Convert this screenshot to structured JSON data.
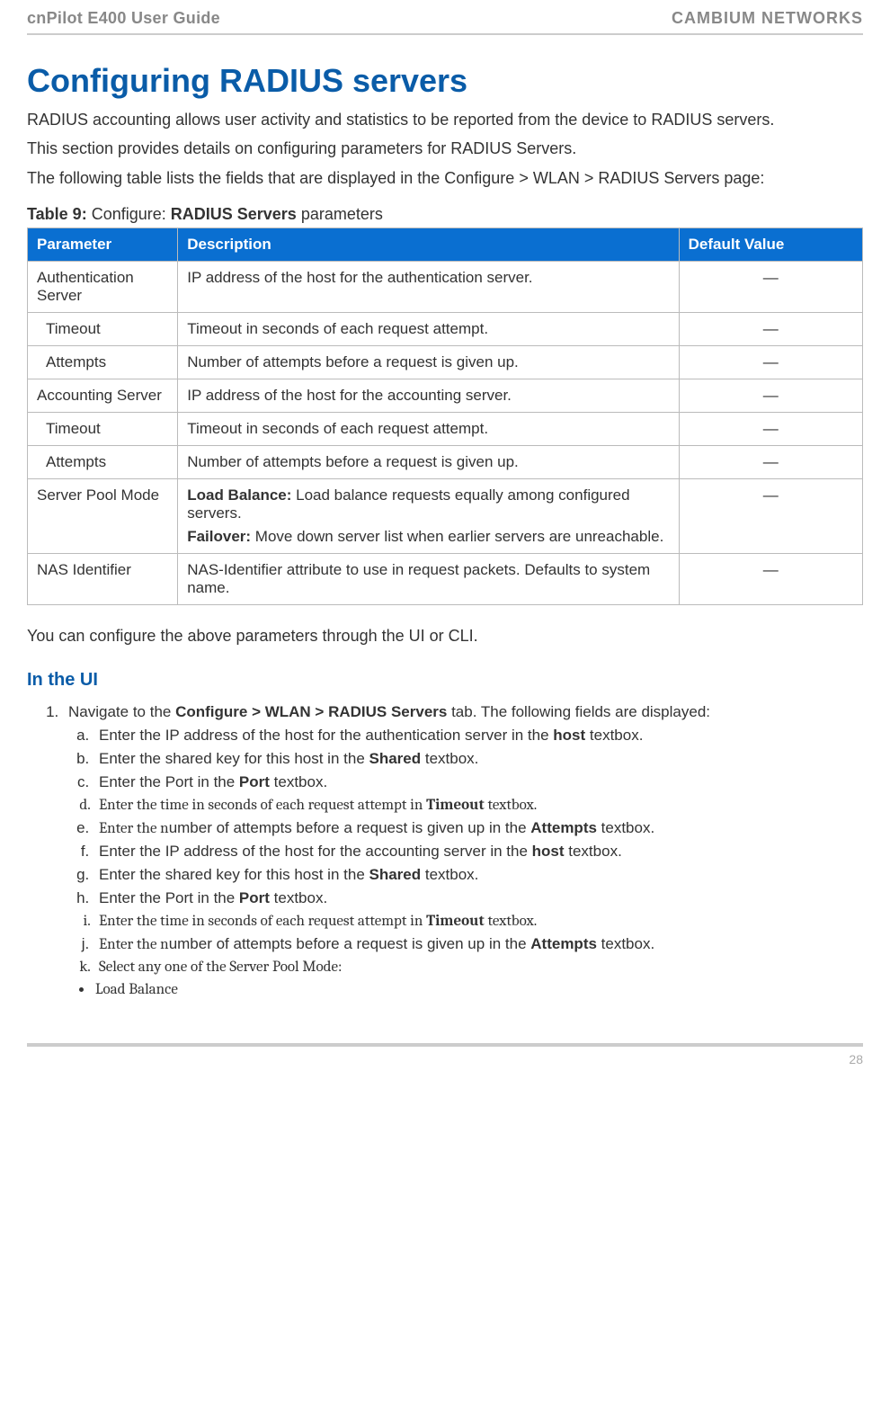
{
  "header": {
    "doc_title": "cnPilot E400 User Guide",
    "brand": "CAMBIUM NETWORKS"
  },
  "section": {
    "title": "Configuring RADIUS servers",
    "p1": "RADIUS accounting allows user activity and statistics to be reported from the device to RADIUS servers.",
    "p2": "This section provides details on configuring parameters for RADIUS Servers.",
    "p3": "The following table lists the fields that are displayed in the Configure > WLAN > RADIUS Servers page:"
  },
  "table": {
    "caption_prefix": "Table 9:",
    "caption_mid": " Configure: ",
    "caption_bold2": "RADIUS Servers",
    "caption_suffix": " parameters",
    "headers": {
      "parameter": "Parameter",
      "description": "Description",
      "default_value": "Default Value"
    },
    "rows": [
      {
        "param": "Authentication Server",
        "indent": 0,
        "desc_plain": "IP address of the host for the authentication server.",
        "default": "—"
      },
      {
        "param": "Timeout",
        "indent": 1,
        "desc_plain": "Timeout in seconds of each request attempt.",
        "default": "—"
      },
      {
        "param": "Attempts",
        "indent": 1,
        "desc_plain": "Number of attempts before a request is given up.",
        "default": "—"
      },
      {
        "param": "Accounting Server",
        "indent": 0,
        "desc_plain": "IP address of the host for the accounting server.",
        "default": "—"
      },
      {
        "param": "Timeout",
        "indent": 1,
        "desc_plain": "Timeout in seconds of each request attempt.",
        "default": "—"
      },
      {
        "param": "Attempts",
        "indent": 1,
        "desc_plain": "Number of attempts before a request is given up.",
        "default": "—"
      },
      {
        "param": "Server Pool Mode",
        "indent": 0,
        "desc_rich": [
          {
            "bold": "Load Balance:",
            "text": " Load balance requests equally among configured servers."
          },
          {
            "bold": "Failover:",
            "text": " Move down server list when earlier servers are unreachable."
          }
        ],
        "default": "—"
      },
      {
        "param": "NAS Identifier",
        "indent": 0,
        "desc_plain": "NAS-Identifier attribute to use in request packets. Defaults to system name.",
        "default": "—"
      }
    ]
  },
  "post_table_text": "You can configure the above parameters through the UI or CLI.",
  "ui_heading": "In the UI",
  "steps": {
    "step1_pre": "Navigate to the ",
    "step1_bold": "Configure > WLAN > RADIUS Servers",
    "step1_post": " tab. The following fields are displayed:",
    "substeps": [
      {
        "pre": "Enter the IP address of the host for the authentication server in the ",
        "bold": "host",
        "post": " textbox.",
        "serif": false
      },
      {
        "pre": "Enter the shared key for this host in the ",
        "bold": "Shared",
        "post": " textbox.",
        "serif": false
      },
      {
        "pre": "Enter the Port in the ",
        "bold": "Port",
        "post": " textbox.",
        "serif": false
      },
      {
        "pre": "Enter the time in seconds of each request attempt in ",
        "bold": "Timeout",
        "post": " textbox.",
        "serif": true
      },
      {
        "pre_serif": "Enter the n",
        "pre": "umber of attempts before a request is given up in the ",
        "bold": "Attempts",
        "post": " textbox.",
        "serif": false,
        "mixed": true
      },
      {
        "pre": "Enter the IP address of the host for the accounting server in the ",
        "bold": "host",
        "post": " textbox.",
        "serif": false
      },
      {
        "pre": "Enter the shared key for this host in the ",
        "bold": "Shared",
        "post": " textbox.",
        "serif": false
      },
      {
        "pre": "Enter the Port in the ",
        "bold": "Port",
        "post": " textbox.",
        "serif": false
      },
      {
        "pre": "Enter the time in seconds of each request attempt in ",
        "bold": "Timeout",
        "post": " textbox.",
        "serif": true
      },
      {
        "pre_serif": "Enter the n",
        "pre": "umber of attempts before a request is given up in the ",
        "bold": "Attempts",
        "post": " textbox.",
        "serif": false,
        "mixed": true
      },
      {
        "pre": "Select any one of the Server Pool Mode:",
        "bold": "",
        "post": "",
        "serif": true
      }
    ],
    "bullets": [
      {
        "text": "Load Balance",
        "serif": true
      }
    ]
  },
  "footer": {
    "page_number": "28"
  }
}
